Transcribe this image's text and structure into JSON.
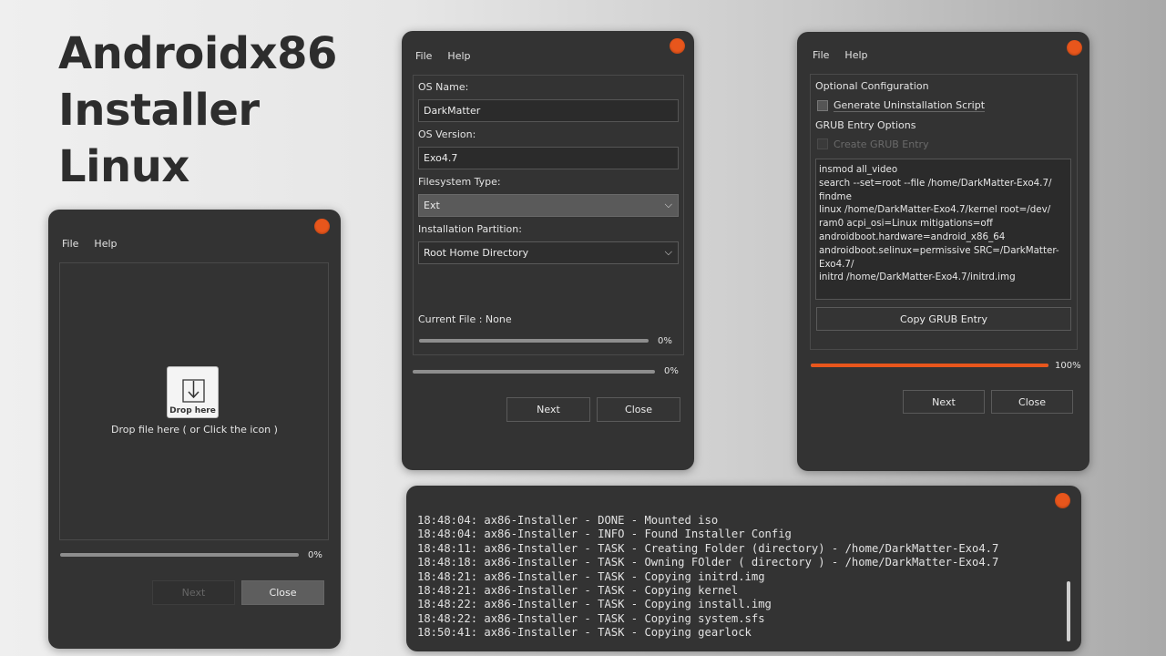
{
  "hero": {
    "lines": [
      "Androidx86",
      "Installer",
      "Linux"
    ]
  },
  "menu": {
    "file": "File",
    "help": "Help"
  },
  "drop_window": {
    "icon_caption": "Drop here",
    "hint": "Drop file here ( or Click the icon )",
    "progress": {
      "value": 0,
      "label": "0%"
    },
    "next": "Next",
    "close": "Close"
  },
  "os_window": {
    "os_name_label": "OS Name:",
    "os_name_value": "DarkMatter",
    "os_version_label": "OS Version:",
    "os_version_value": "Exo4.7",
    "fs_label": "Filesystem Type:",
    "fs_value": "Ext",
    "partition_label": "Installation Partition:",
    "partition_value": "Root Home Directory",
    "current_file": "Current File : None",
    "file_progress": {
      "value": 0,
      "label": "0%"
    },
    "total_progress": {
      "value": 0,
      "label": "0%"
    },
    "next": "Next",
    "close": "Close"
  },
  "grub_window": {
    "optional_title": "Optional Configuration",
    "gen_uninstall": "Generate Uninstallation Script",
    "grub_title": "GRUB Entry Options",
    "create_grub": "Create GRUB Entry",
    "grub_text": [
      "insmod all_video",
      "search --set=root --file /home/DarkMatter-Exo4.7/",
      "findme",
      "linux /home/DarkMatter-Exo4.7/kernel root=/dev/",
      "ram0 acpi_osi=Linux mitigations=off",
      "androidboot.hardware=android_x86_64",
      "androidboot.selinux=permissive SRC=/DarkMatter-",
      "Exo4.7/",
      "initrd /home/DarkMatter-Exo4.7/initrd.img"
    ],
    "copy_button": "Copy GRUB Entry",
    "progress": {
      "value": 100,
      "label": "100%"
    },
    "next": "Next",
    "close": "Close"
  },
  "log_window": {
    "lines": [
      "18:48:04: ax86-Installer - DONE - Mounted iso",
      "18:48:04: ax86-Installer - INFO - Found Installer Config",
      "18:48:11: ax86-Installer - TASK - Creating Folder (directory) - /home/DarkMatter-Exo4.7",
      "18:48:18: ax86-Installer - TASK - Owning FOlder ( directory ) - /home/DarkMatter-Exo4.7",
      "18:48:21: ax86-Installer - TASK - Copying initrd.img",
      "18:48:21: ax86-Installer - TASK - Copying kernel",
      "18:48:22: ax86-Installer - TASK - Copying install.img",
      "18:48:22: ax86-Installer - TASK - Copying system.sfs",
      "18:50:41: ax86-Installer - TASK - Copying gearlock"
    ]
  },
  "colors": {
    "accent": "#e8561c",
    "window_bg": "#333333"
  }
}
